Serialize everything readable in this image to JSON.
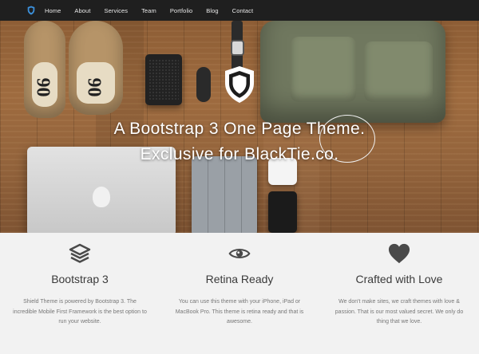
{
  "nav": {
    "brand_icon": "shield-icon",
    "links": [
      "Home",
      "About",
      "Services",
      "Team",
      "Portfolio",
      "Blog",
      "Contact"
    ]
  },
  "hero": {
    "logo_icon": "shield-icon",
    "title_line1": "A Bootstrap 3 One Page Theme.",
    "title_line2": "Exclusive for BlackTie.co.",
    "shoe_number": "06"
  },
  "features": [
    {
      "icon": "layers-icon",
      "title": "Bootstrap 3",
      "description": "Shield Theme is powered by Bootstrap 3. The incredible Mobile First Framework is the best option to run your website."
    },
    {
      "icon": "eye-icon",
      "title": "Retina Ready",
      "description": "You can use this theme with your iPhone, iPad or MacBook Pro. This theme is retina ready and that is awesome."
    },
    {
      "icon": "heart-icon",
      "title": "Crafted with Love",
      "description": "We don't make sites, we craft themes with love & passion. That is our most valued secret. We only do thing that we love."
    }
  ],
  "colors": {
    "navbar": "#1f1f1f",
    "accent_blue": "#3b8fd9",
    "features_bg": "#f2f2f2",
    "icon_dark": "#4a4a4a"
  }
}
